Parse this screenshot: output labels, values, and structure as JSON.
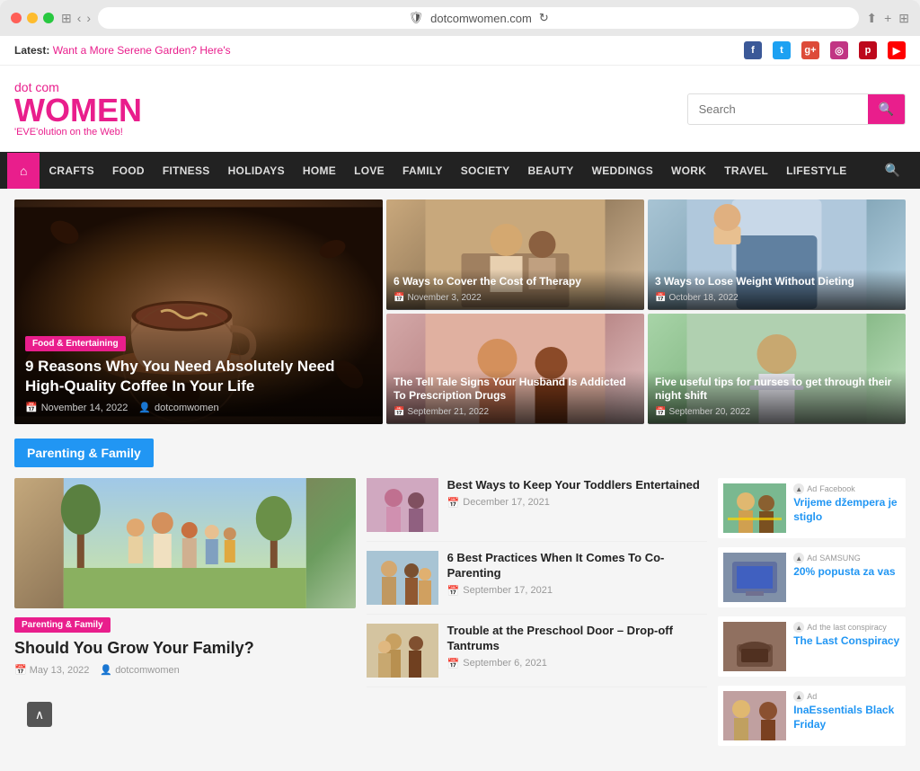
{
  "browser": {
    "url": "dotcomwomen.com",
    "reload_icon": "↻"
  },
  "topbar": {
    "latest_label": "Latest:",
    "latest_link": "Want a More Serene Garden? Here's",
    "social": [
      "f",
      "t",
      "g+",
      "📷",
      "p",
      "▶"
    ]
  },
  "header": {
    "logo_dotcom": "dot com",
    "logo_women": "WOMEN",
    "logo_tagline": "'EVE'olution on the Web!",
    "search_placeholder": "Search"
  },
  "nav": {
    "home_icon": "⌂",
    "items": [
      "CRAFTS",
      "FOOD",
      "FITNESS",
      "HOLIDAYS",
      "HOME",
      "LOVE",
      "FAMILY",
      "SOCIETY",
      "BEAUTY",
      "WEDDINGS",
      "WORK",
      "TRAVEL",
      "LIFESTYLE"
    ],
    "search_icon": "🔍"
  },
  "hero": {
    "main": {
      "category": "Food & Entertaining",
      "title": "9 Reasons Why You Need Absolutely Need High-Quality Coffee In Your Life",
      "date": "November 14, 2022",
      "author": "dotcomwomen"
    },
    "cards": [
      {
        "title": "6 Ways to Cover the Cost of Therapy",
        "date": "November 3, 2022",
        "color_class": "sc1"
      },
      {
        "title": "3 Ways to Lose Weight Without Dieting",
        "date": "October 18, 2022",
        "color_class": "sc2"
      },
      {
        "title": "The Tell Tale Signs Your Husband Is Addicted To Prescription Drugs",
        "date": "September 21, 2022",
        "color_class": "sc3"
      },
      {
        "title": "Five useful tips for nurses to get through their night shift",
        "date": "September 20, 2022",
        "color_class": "sc4"
      }
    ]
  },
  "parenting_section": {
    "label": "Parenting & Family",
    "main_article": {
      "badge": "Parenting & Family",
      "title": "Should You Grow Your Family?",
      "date": "May 13, 2022",
      "author": "dotcomwomen"
    },
    "articles": [
      {
        "title": "Best Ways to Keep Your Toddlers Entertained",
        "date": "December 17, 2021",
        "color_class": "ai1"
      },
      {
        "title": "6 Best Practices When It Comes To Co-Parenting",
        "date": "September 17, 2021",
        "color_class": "ai2"
      },
      {
        "title": "Trouble at the Preschool Door – Drop-off Tantrums",
        "date": "September 6, 2021",
        "color_class": "ai3"
      }
    ]
  },
  "sidebar": {
    "ads": [
      {
        "title": "Vrijeme džempera je stiglo",
        "sponsor": "Facebook",
        "color_class": "ad1-img",
        "badge": "Ad"
      },
      {
        "title": "20% popusta za vas",
        "sponsor": "SAMSUNG",
        "color_class": "ad2-img",
        "badge": "Ad"
      },
      {
        "title": "The Last Conspiracy",
        "sponsor": "the last conspiracy",
        "color_class": "ad3-img",
        "badge": "Ad"
      },
      {
        "title": "InaEssentials Black Friday",
        "sponsor": "",
        "color_class": "ad4-img",
        "badge": "Ad"
      }
    ]
  },
  "scroll_top": "∧"
}
